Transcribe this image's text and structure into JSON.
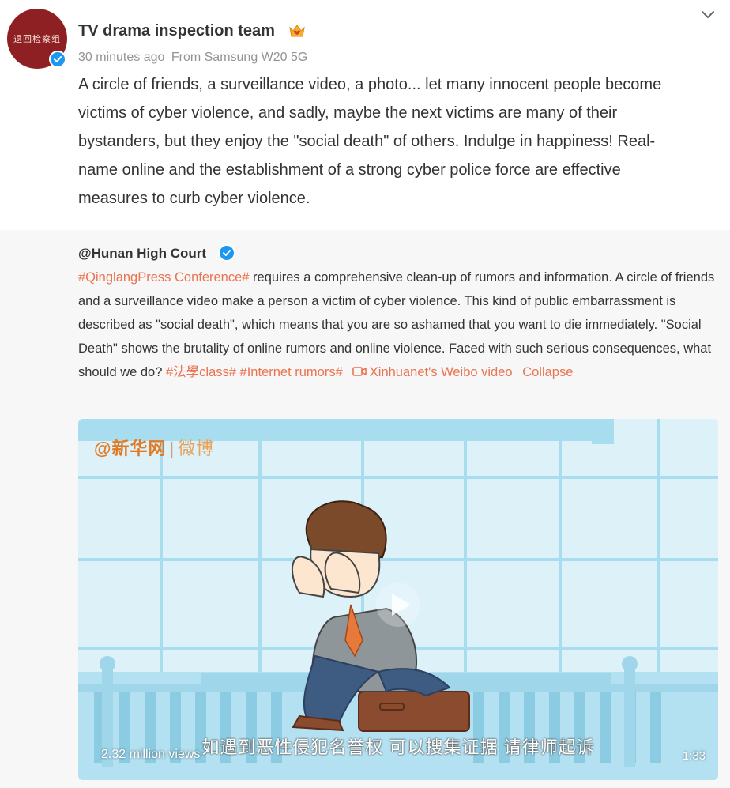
{
  "post": {
    "avatar_text": "退回检察组",
    "username": "TV drama inspection team",
    "time": "30 minutes ago",
    "source": "From Samsung W20 5G",
    "text": "A circle of friends, a surveillance video, a photo... let many innocent people become victims of cyber violence, and sadly, maybe the next victims are many of their bystanders, but they enjoy the \"social death\" of others. Indulge in happiness! Real-name online and the establishment of a strong cyber police force are effective measures to curb cyber violence.",
    "icons": {
      "verified": "verified-badge-icon",
      "crown": "crown-icon",
      "more": "chevron-down-icon"
    }
  },
  "repost": {
    "author": "@Hunan High Court",
    "tag1": "#QinglangPress Conference#",
    "text1": " requires a comprehensive clean-up of rumors and information. A circle of friends and a surveillance video make a person a victim of cyber violence. This kind of public embarrassment is described as \"social death\", which means that you are so ashamed that you want to die immediately. \"Social Death\" shows the brutality of online rumors and online violence. Faced with such serious consequences, what should we do? ",
    "tag2": "#法學class#",
    "tag3": "#Internet rumors#",
    "video_link": "Xinhuanet's Weibo video",
    "collapse": "Collapse"
  },
  "video": {
    "logo_main": "@新华网",
    "logo_sep": "|",
    "logo_weibo": "微博",
    "subtitle": "如遇到恶性侵犯名誉权 可以搜集证据 请律师起诉",
    "views": "2.32 million views",
    "duration": "1:33"
  },
  "colors": {
    "link": "#eb7350",
    "verified": "#1d98f0",
    "repost_bg": "#f7f7f7",
    "avatar_bg": "#8e1f22"
  }
}
